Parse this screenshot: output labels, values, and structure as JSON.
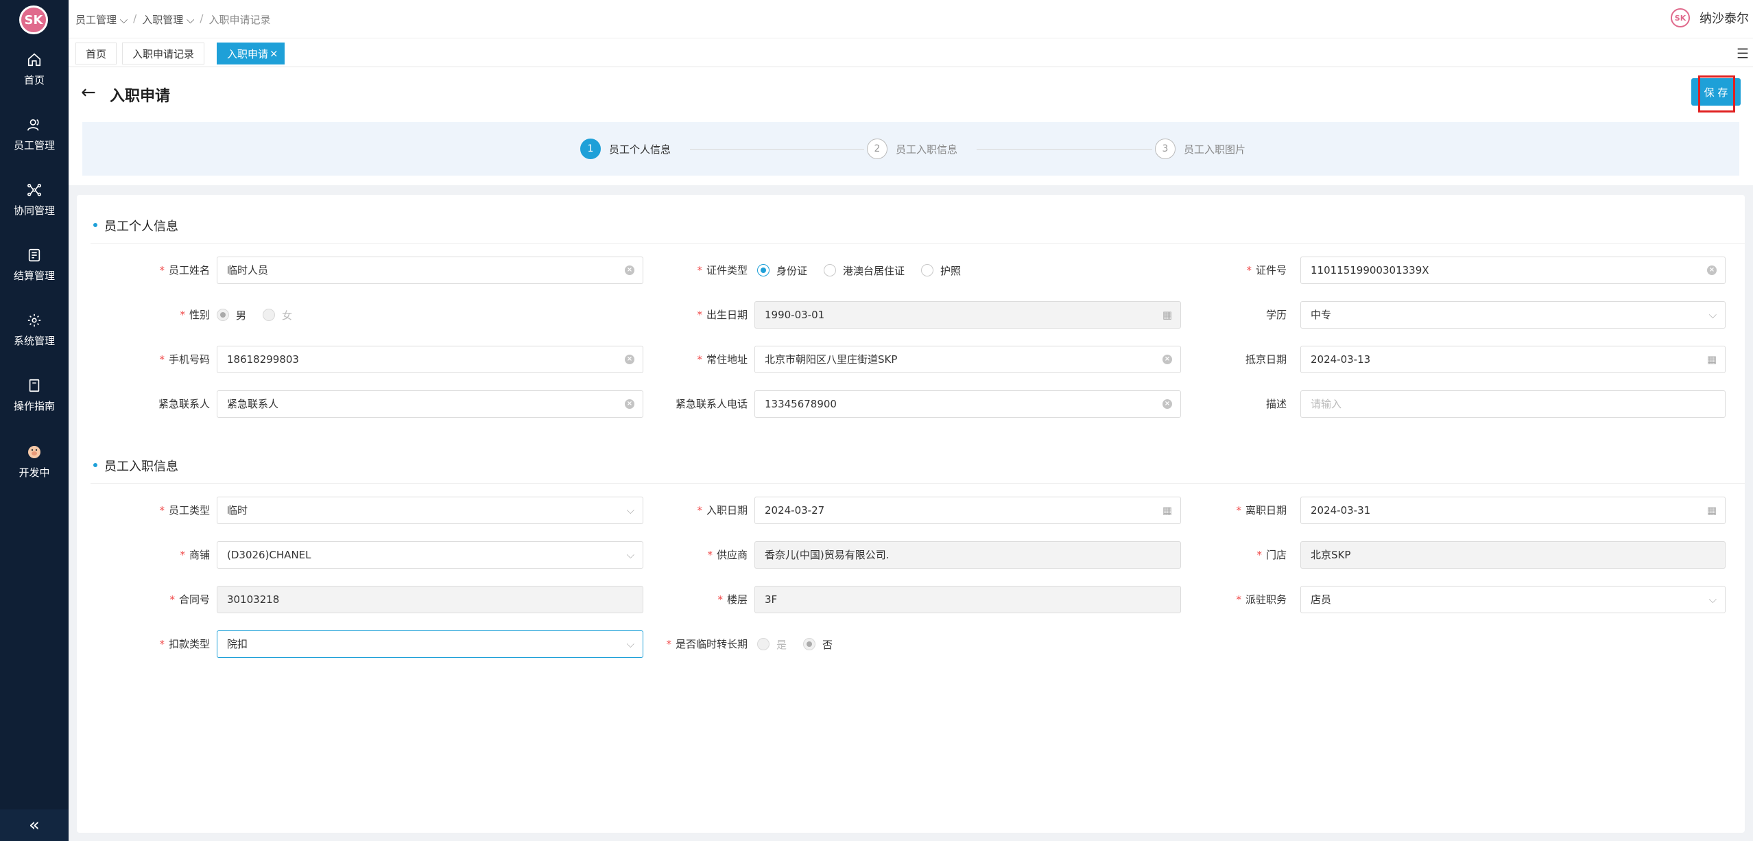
{
  "sidebar": {
    "logo_text": "SK",
    "items": [
      {
        "label": "首页",
        "icon": "home-icon"
      },
      {
        "label": "员工管理",
        "icon": "users-icon"
      },
      {
        "label": "协同管理",
        "icon": "network-icon"
      },
      {
        "label": "结算管理",
        "icon": "ledger-icon"
      },
      {
        "label": "系统管理",
        "icon": "gear-icon"
      },
      {
        "label": "操作指南",
        "icon": "book-icon"
      },
      {
        "label": "开发中",
        "icon": "pig-icon"
      }
    ],
    "collapse_label": "«"
  },
  "breadcrumb": {
    "items": [
      "员工管理",
      "入职管理",
      "入职申请记录"
    ],
    "separator": "/"
  },
  "user": {
    "name": "纳沙泰尔",
    "logo_text": "SK"
  },
  "tabs": [
    {
      "label": "首页"
    },
    {
      "label": "入职申请记录"
    },
    {
      "label": "入职申请"
    }
  ],
  "tab_close": "×",
  "page": {
    "title": "入职申请",
    "save_label": "保 存"
  },
  "steps": [
    {
      "num": "1",
      "label": "员工个人信息"
    },
    {
      "num": "2",
      "label": "员工入职信息"
    },
    {
      "num": "3",
      "label": "员工入职图片"
    }
  ],
  "personal": {
    "section_title": "员工个人信息",
    "name_label": "员工姓名",
    "name_value": "临时人员",
    "id_type_label": "证件类型",
    "id_type_options": [
      "身份证",
      "港澳台居住证",
      "护照"
    ],
    "id_no_label": "证件号",
    "id_no_value": "11011519900301339X",
    "gender_label": "性别",
    "gender_options": [
      "男",
      "女"
    ],
    "birth_label": "出生日期",
    "birth_value": "1990-03-01",
    "edu_label": "学历",
    "edu_value": "中专",
    "phone_label": "手机号码",
    "phone_value": "18618299803",
    "address_label": "常住地址",
    "address_value": "北京市朝阳区八里庄街道SKP",
    "arrive_label": "抵京日期",
    "arrive_value": "2024-03-13",
    "contact_label": "紧急联系人",
    "contact_value": "紧急联系人",
    "contact_phone_label": "紧急联系人电话",
    "contact_phone_value": "13345678900",
    "desc_label": "描述",
    "desc_placeholder": "请输入"
  },
  "job": {
    "section_title": "员工入职信息",
    "type_label": "员工类型",
    "type_value": "临时",
    "join_label": "入职日期",
    "join_value": "2024-03-27",
    "leave_label": "离职日期",
    "leave_value": "2024-03-31",
    "shop_label": "商铺",
    "shop_value": "(D3026)CHANEL",
    "supplier_label": "供应商",
    "supplier_value": "香奈儿(中国)贸易有限公司.",
    "store_label": "门店",
    "store_value": "北京SKP",
    "contract_label": "合同号",
    "contract_value": "30103218",
    "floor_label": "楼层",
    "floor_value": "3F",
    "post_label": "派驻职务",
    "post_value": "店员",
    "deduct_label": "扣款类型",
    "deduct_value": "院扣",
    "extend_label": "是否临时转长期",
    "extend_options": [
      "是",
      "否"
    ]
  }
}
